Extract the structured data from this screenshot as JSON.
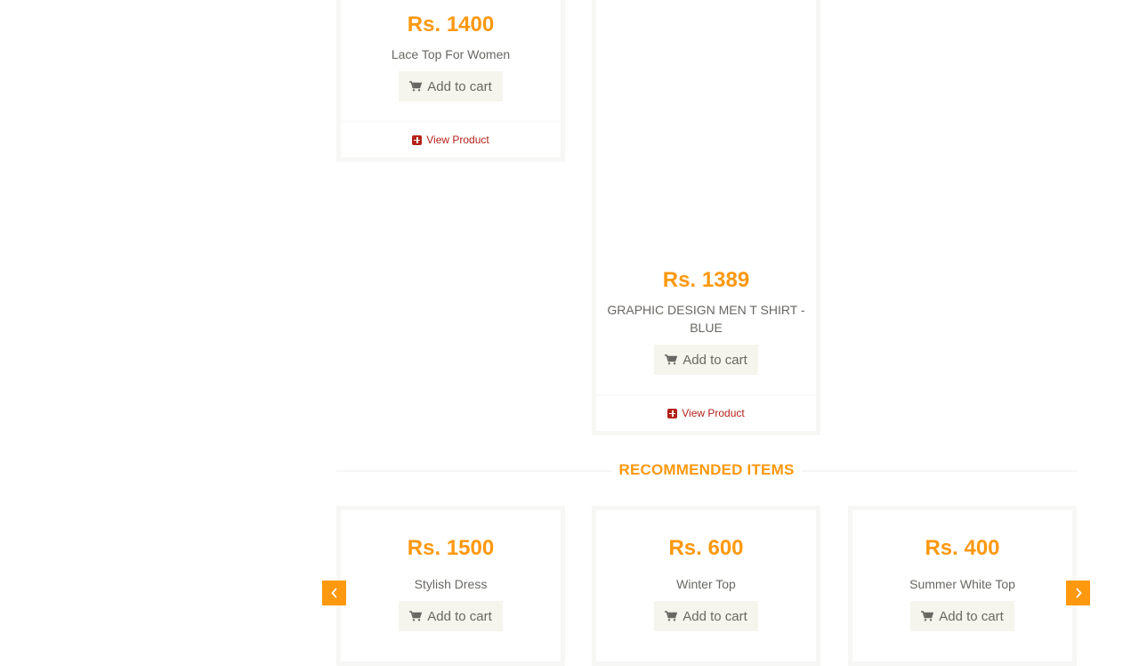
{
  "features_items": [
    {
      "price": "Rs. 1400",
      "name": "Lace Top For Women",
      "add_to_cart": "Add to cart",
      "view_product": "View Product"
    },
    {
      "price": "Rs. 1389",
      "name": "GRAPHIC DESIGN MEN T SHIRT - BLUE",
      "add_to_cart": "Add to cart",
      "view_product": "View Product"
    }
  ],
  "recommended": {
    "title": "RECOMMENDED ITEMS",
    "items": [
      {
        "price": "Rs. 1500",
        "name": "Stylish Dress",
        "add_to_cart": "Add to cart"
      },
      {
        "price": "Rs. 600",
        "name": "Winter Top",
        "add_to_cart": "Add to cart"
      },
      {
        "price": "Rs. 400",
        "name": "Summer White Top",
        "add_to_cart": "Add to cart"
      }
    ],
    "prev_icon": "chevron-left-icon",
    "next_icon": "chevron-right-icon"
  },
  "colors": {
    "accent": "#FE980F",
    "link": "#B4221A",
    "button_bg": "#F5F5ED",
    "text": "#696763"
  }
}
